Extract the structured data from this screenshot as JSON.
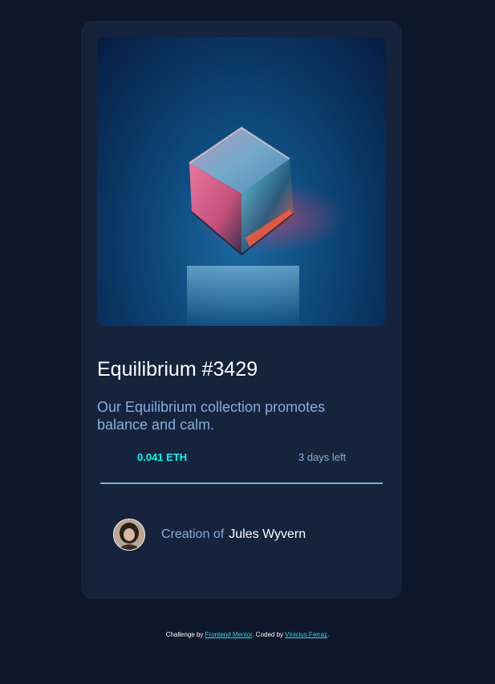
{
  "nft": {
    "image_alt": "Equilibrium cube",
    "title": "Equilibrium #3429",
    "description": "Our Equilibrium collection promotes balance and calm.",
    "price": "0.041 ETH",
    "time_left": "3 days left"
  },
  "creator": {
    "label": "Creation of",
    "name": "Jules Wyvern"
  },
  "attribution": {
    "prefix": "Challenge by",
    "challenge_link": "Frontend Mentor",
    "middle": ". Coded by",
    "author_link": "Vinicius Ferraz",
    "suffix": "."
  },
  "colors": {
    "page_background": "#0d1729",
    "card_background": "#15233d",
    "accent_cyan": "#00fff8",
    "soft_blue": "#8bacd9",
    "white": "#ffffff"
  },
  "icons": {
    "price_icon": "ethereum-icon",
    "time_icon": "clock-icon"
  }
}
